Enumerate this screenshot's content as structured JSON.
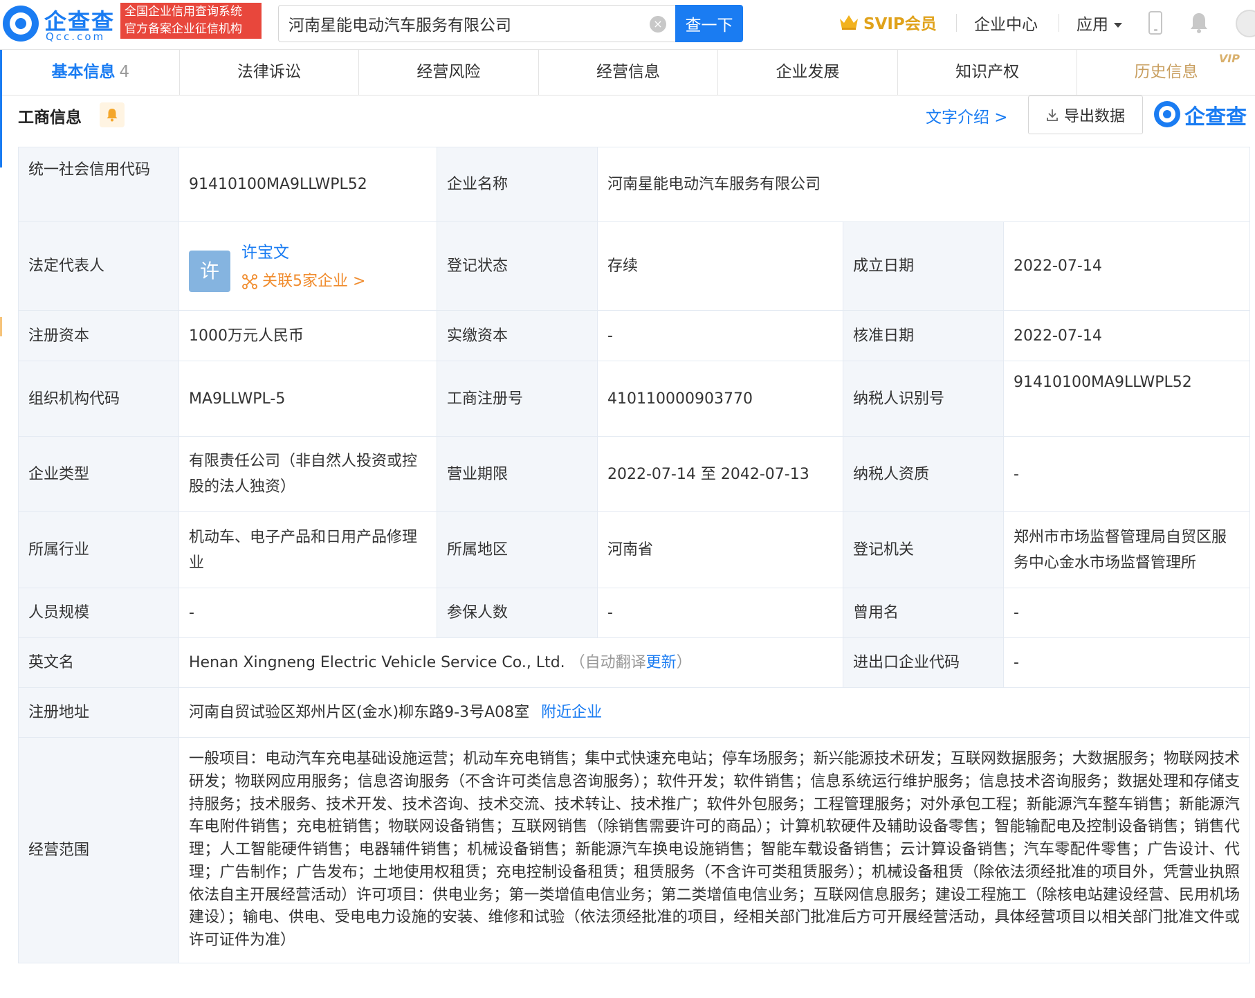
{
  "header": {
    "logo_cn": "企查查",
    "logo_en": "Qcc.com",
    "tagline_line1": "全国企业信用查询系统",
    "tagline_line2": "官方备案企业征信机构",
    "search_value": "河南星能电动汽车服务有限公司",
    "search_button": "查一下",
    "svip": "SVIP会员",
    "enterprise_center": "企业中心",
    "apps": "应用"
  },
  "tabs": [
    {
      "label": "基本信息",
      "count": "4"
    },
    {
      "label": "法律诉讼"
    },
    {
      "label": "经营风险"
    },
    {
      "label": "经营信息"
    },
    {
      "label": "企业发展"
    },
    {
      "label": "知识产权"
    },
    {
      "label": "历史信息",
      "tag": "VIP"
    }
  ],
  "section": {
    "title": "工商信息",
    "text_intro": "文字介绍 >",
    "export": "导出数据",
    "brand": "企查查"
  },
  "info": {
    "credit_code_label": "统一社会信用代码",
    "credit_code": "91410100MA9LLWPL52",
    "company_name_label": "企业名称",
    "company_name": "河南星能电动汽车服务有限公司",
    "legal_rep_label": "法定代表人",
    "legal_rep_avatar": "许",
    "legal_rep_name": "许宝文",
    "legal_rep_related": "关联5家企业 >",
    "status_label": "登记状态",
    "status": "存续",
    "founded_label": "成立日期",
    "founded": "2022-07-14",
    "reg_capital_label": "注册资本",
    "reg_capital": "1000万元人民币",
    "paid_capital_label": "实缴资本",
    "paid_capital": "-",
    "approval_date_label": "核准日期",
    "approval_date": "2022-07-14",
    "org_code_label": "组织机构代码",
    "org_code": "MA9LLWPL-5",
    "reg_no_label": "工商注册号",
    "reg_no": "410110000903770",
    "taxpayer_id_label": "纳税人识别号",
    "taxpayer_id": "91410100MA9LLWPL52",
    "company_type_label": "企业类型",
    "company_type": "有限责任公司（非自然人投资或控股的法人独资）",
    "term_label": "营业期限",
    "term": "2022-07-14 至 2042-07-13",
    "taxpayer_qual_label": "纳税人资质",
    "taxpayer_qual": "-",
    "industry_label": "所属行业",
    "industry": "机动车、电子产品和日用产品修理业",
    "region_label": "所属地区",
    "region": "河南省",
    "reg_authority_label": "登记机关",
    "reg_authority": "郑州市市场监督管理局自贸区服务中心金水市场监督管理所",
    "staff_size_label": "人员规模",
    "staff_size": "-",
    "insured_label": "参保人数",
    "insured": "-",
    "former_name_label": "曾用名",
    "former_name": "-",
    "english_name_label": "英文名",
    "english_name": "Henan Xingneng Electric Vehicle Service Co., Ltd.",
    "auto_translate_open": "（自动翻译",
    "update": "更新",
    "auto_translate_close": "）",
    "import_export_label": "进出口企业代码",
    "import_export": "-",
    "address_label": "注册地址",
    "address": "河南自贸试验区郑州片区(金水)柳东路9-3号A08室",
    "nearby": "附近企业",
    "scope_label": "经营范围",
    "scope": "一般项目：电动汽车充电基础设施运营；机动车充电销售；集中式快速充电站；停车场服务；新兴能源技术研发；互联网数据服务；大数据服务；物联网技术研发；物联网应用服务；信息咨询服务（不含许可类信息咨询服务）；软件开发；软件销售；信息系统运行维护服务；信息技术咨询服务；数据处理和存储支持服务；技术服务、技术开发、技术咨询、技术交流、技术转让、技术推广；软件外包服务；工程管理服务；对外承包工程；新能源汽车整车销售；新能源汽车电附件销售；充电桩销售；物联网设备销售；互联网销售（除销售需要许可的商品）；计算机软硬件及辅助设备零售；智能输配电及控制设备销售；销售代理；人工智能硬件销售；电器辅件销售；机械设备销售；新能源汽车换电设施销售；智能车载设备销售；云计算设备销售；汽车零配件零售；广告设计、代理；广告制作；广告发布；土地使用权租赁；充电控制设备租赁；租赁服务（不含许可类租赁服务）；机械设备租赁（除依法须经批准的项目外，凭营业执照依法自主开展经营活动）许可项目：供电业务；第一类增值电信业务；第二类增值电信业务；互联网信息服务；建设工程施工（除核电站建设经营、民用机场建设）；输电、供电、受电电力设施的安装、维修和试验（依法须经批准的项目，经相关部门批准后方可开展经营活动，具体经营项目以相关部门批准文件或许可证件为准）"
  }
}
